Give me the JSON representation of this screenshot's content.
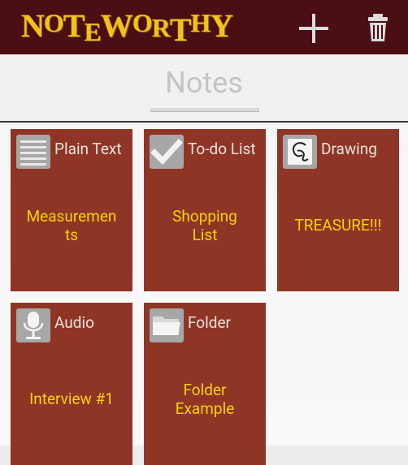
{
  "app": {
    "logo_text": "NoteWorthy",
    "actions": [
      {
        "label": "add",
        "icon": "plus-icon"
      },
      {
        "label": "delete",
        "icon": "trash-icon"
      }
    ]
  },
  "header": {
    "title": "Notes"
  },
  "colors": {
    "appbar": "#4a0e14",
    "logo": "#f2c21a",
    "tile": "#8f3526",
    "tile_title": "#f4d20c",
    "tile_type": "#e9e3dc",
    "icon_bg": "#a7a7a7"
  },
  "tiles": [
    {
      "type": "Plain Text",
      "icon": "lines-icon",
      "name": "Measurements",
      "lines": [
        "Measuremen",
        "ts"
      ]
    },
    {
      "type": "To-do List",
      "icon": "checkmark-icon",
      "name": "Shopping List",
      "lines": [
        "Shopping",
        "List"
      ]
    },
    {
      "type": "Drawing",
      "icon": "drawing-icon",
      "name": "TREASURE!!!",
      "lines": [
        "TREASURE!!!"
      ]
    },
    {
      "type": "Audio",
      "icon": "microphone-icon",
      "name": "Interview #1",
      "lines": [
        "Interview #1"
      ]
    },
    {
      "type": "Folder",
      "icon": "folder-icon",
      "name": "Folder Example",
      "lines": [
        "Folder",
        "Example"
      ]
    }
  ]
}
